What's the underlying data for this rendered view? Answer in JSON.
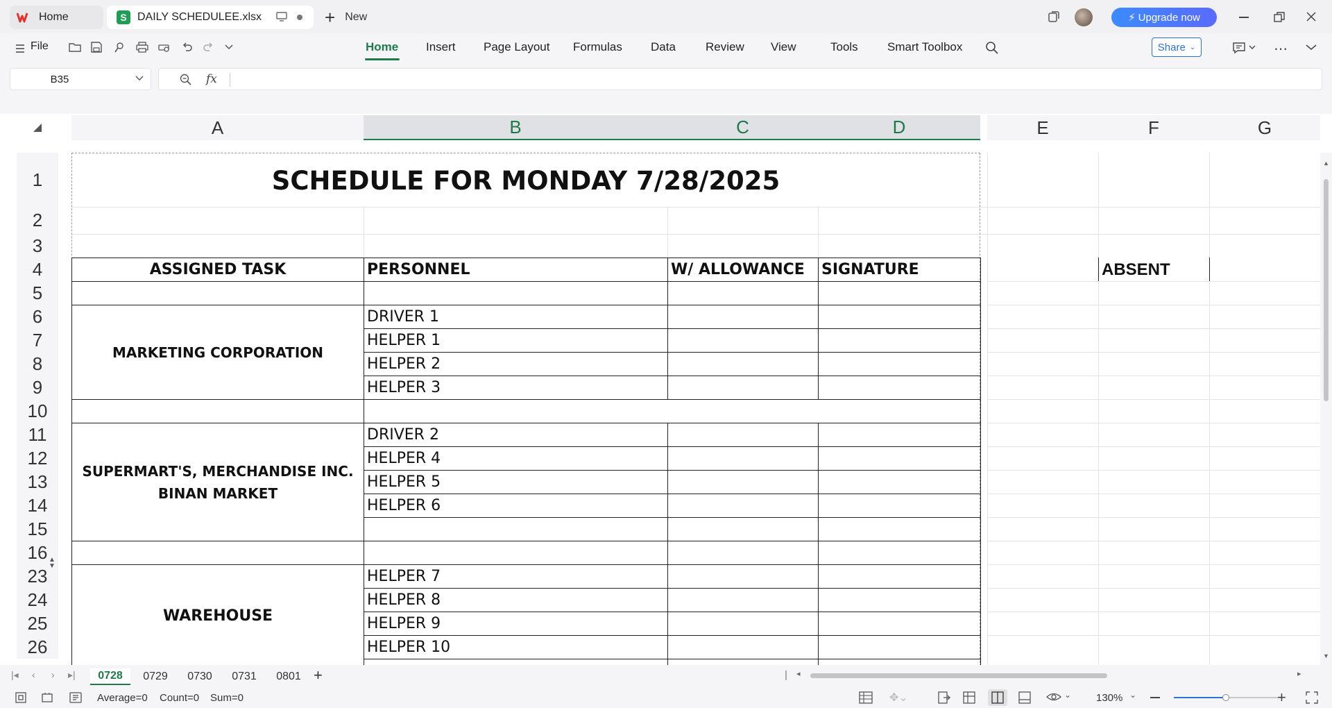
{
  "titlebar": {
    "home_tab": "Home",
    "file_tab": "DAILY SCHEDULEE.xlsx",
    "new_tab": "New",
    "upgrade": "Upgrade now"
  },
  "menubar": {
    "file": "File",
    "items": [
      "Home",
      "Insert",
      "Page Layout",
      "Formulas",
      "Data",
      "Review",
      "View",
      "Tools",
      "Smart Toolbox"
    ],
    "share": "Share"
  },
  "formula_bar": {
    "name_box": "B35",
    "fx": "fx",
    "value": ""
  },
  "columns": [
    "A",
    "B",
    "C",
    "D",
    "E",
    "F",
    "G"
  ],
  "rows": [
    "1",
    "2",
    "3",
    "4",
    "5",
    "6",
    "7",
    "8",
    "9",
    "10",
    "11",
    "12",
    "13",
    "14",
    "15",
    "16",
    "23",
    "24",
    "25",
    "26"
  ],
  "sheet": {
    "title": "SCHEDULE FOR MONDAY 7/28/2025",
    "headers": {
      "task": "ASSIGNED TASK",
      "personnel": "PERSONNEL",
      "allowance": "W/ ALLOWANCE",
      "signature": "SIGNATURE"
    },
    "absent_label": "ABSENT",
    "groups": [
      {
        "task_line1": "MARKETING CORPORATION",
        "task_line2": "",
        "personnel": [
          "DRIVER 1",
          "HELPER 1",
          "HELPER 2",
          "HELPER 3"
        ]
      },
      {
        "task_line1": "SUPERMART'S, MERCHANDISE INC.",
        "task_line2": "BINAN MARKET",
        "personnel": [
          "DRIVER 2",
          "HELPER 4",
          "HELPER 5",
          "HELPER 6"
        ]
      },
      {
        "task_line1": "WAREHOUSE",
        "task_line2": "",
        "personnel": [
          "HELPER 7",
          "HELPER 8",
          "HELPER 9",
          "HELPER 10"
        ]
      }
    ]
  },
  "sheet_tabs": [
    "0728",
    "0729",
    "0730",
    "0731",
    "0801"
  ],
  "status": {
    "average": "Average=0",
    "count": "Count=0",
    "sum": "Sum=0",
    "zoom": "130%"
  },
  "colors": {
    "accent": "#1f7a4a",
    "share": "#2a72d8",
    "upgrade": "#3b8bff"
  }
}
